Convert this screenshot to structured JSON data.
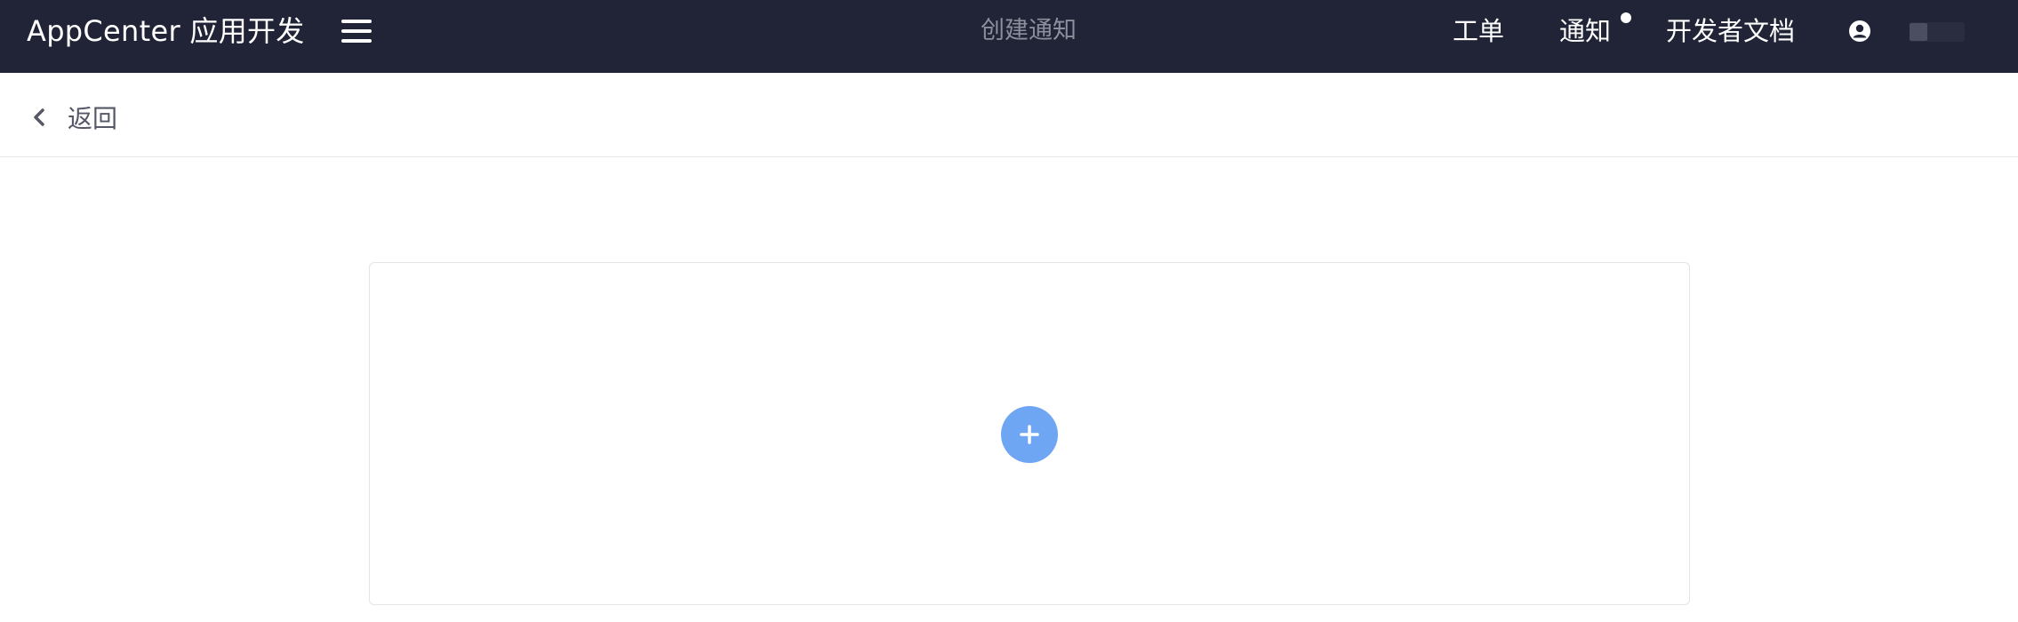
{
  "topbar": {
    "brand": "AppCenter 应用开发",
    "page_heading": "创建通知",
    "nav": {
      "ticket": "工单",
      "notify": "通知",
      "docs": "开发者文档"
    },
    "icons": {
      "menu": "hamburger-icon",
      "notify_badge": "unread-dot",
      "user": "user-circle-icon",
      "avatar": "avatar"
    }
  },
  "subbar": {
    "back_label": "返回",
    "back_icon": "chevron-left-icon"
  },
  "main": {
    "add_icon": "plus-icon",
    "accent_color": "#6ea6f3"
  },
  "colors": {
    "topbar_bg": "#212436",
    "page_bg": "#ffffff"
  }
}
